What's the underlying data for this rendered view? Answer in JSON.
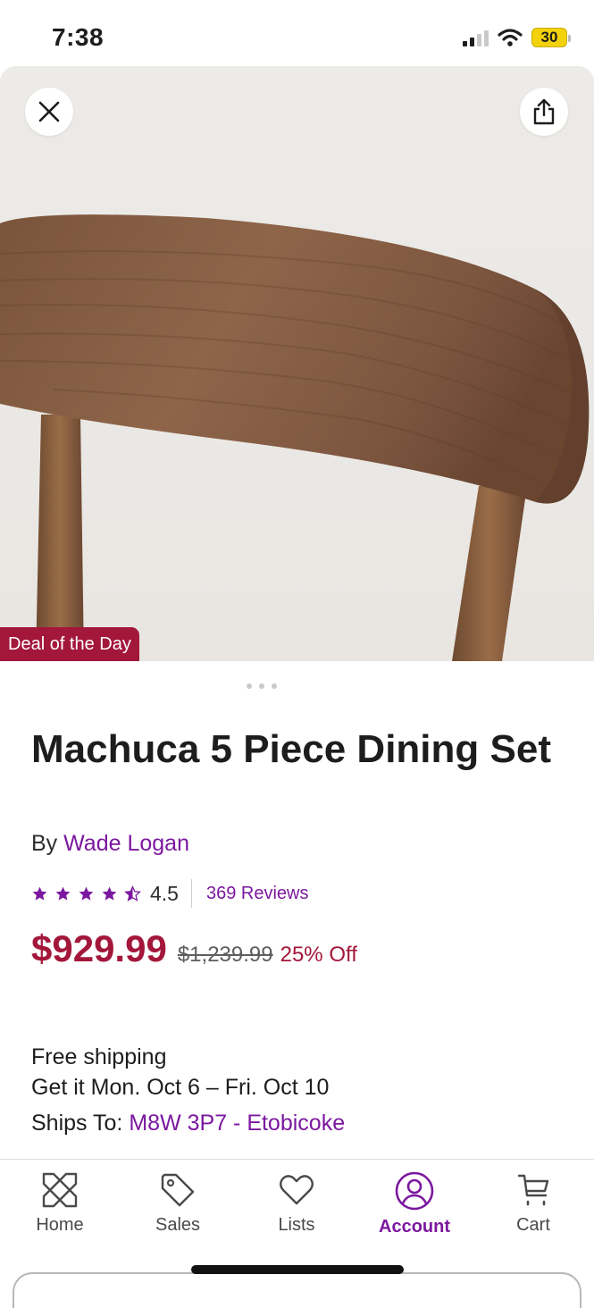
{
  "status_bar": {
    "time": "7:38",
    "battery": "30"
  },
  "hero": {
    "badge": "Deal of the Day",
    "image_page_count": 3,
    "active_image_index": 0
  },
  "product": {
    "title": "Machuca 5 Piece Dining Set",
    "by_label": "By",
    "brand": "Wade Logan",
    "rating": "4.5",
    "rating_stars": 4.5,
    "reviews": "369 Reviews",
    "price": "$929.99",
    "original_price": "$1,239.99",
    "discount": "25% Off"
  },
  "shipping": {
    "free_shipping": "Free shipping",
    "delivery": "Get it Mon. Oct 6 – Fri. Oct 10",
    "ships_to_label": "Ships To:",
    "ships_to_location": "M8W 3P7 - Etobicoke"
  },
  "tab_bar": {
    "home": "Home",
    "sales": "Sales",
    "lists": "Lists",
    "account": "Account",
    "cart": "Cart",
    "active": "account"
  },
  "colors": {
    "accent_purple": "#7b189f",
    "sale_red": "#a3173b",
    "text_dark": "#1d1d1d"
  },
  "icons": [
    "close-icon",
    "share-icon",
    "star-icon",
    "half-star-icon",
    "home-icon",
    "tag-icon",
    "heart-icon",
    "account-icon",
    "cart-icon"
  ]
}
